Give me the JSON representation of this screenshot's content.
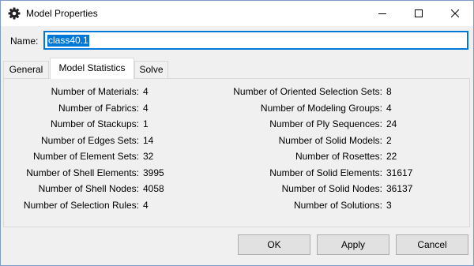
{
  "window": {
    "title": "Model Properties",
    "icon": "gear-icon"
  },
  "name_field": {
    "label": "Name:",
    "value": "class40.1"
  },
  "tabs": [
    {
      "label": "General"
    },
    {
      "label": "Model Statistics",
      "active": true
    },
    {
      "label": "Solve"
    }
  ],
  "stats_left": [
    {
      "label": "Number of Materials:",
      "value": "4"
    },
    {
      "label": "Number of Fabrics:",
      "value": "4"
    },
    {
      "label": "Number of Stackups:",
      "value": "1"
    },
    {
      "label": "Number of Edges Sets:",
      "value": "14"
    },
    {
      "label": "Number of Element Sets:",
      "value": "32"
    },
    {
      "label": "Number of Shell Elements:",
      "value": "3995"
    },
    {
      "label": "Number of Shell Nodes:",
      "value": "4058"
    },
    {
      "label": "Number of Selection Rules:",
      "value": "4"
    }
  ],
  "stats_right": [
    {
      "label": "Number of Oriented Selection Sets:",
      "value": "8"
    },
    {
      "label": "Number of Modeling Groups:",
      "value": "4"
    },
    {
      "label": "Number of Ply Sequences:",
      "value": "24"
    },
    {
      "label": "Number of Solid Models:",
      "value": "2"
    },
    {
      "label": "Number of Rosettes:",
      "value": "22"
    },
    {
      "label": "Number of Solid Elements:",
      "value": "31617"
    },
    {
      "label": "Number of Solid Nodes:",
      "value": "36137"
    },
    {
      "label": "Number of Solutions:",
      "value": "3"
    }
  ],
  "buttons": {
    "ok": "OK",
    "apply": "Apply",
    "cancel": "Cancel"
  },
  "colors": {
    "accent": "#0078d7",
    "dialog_bg": "#f0f0f0",
    "button_bg": "#e1e1e1"
  }
}
